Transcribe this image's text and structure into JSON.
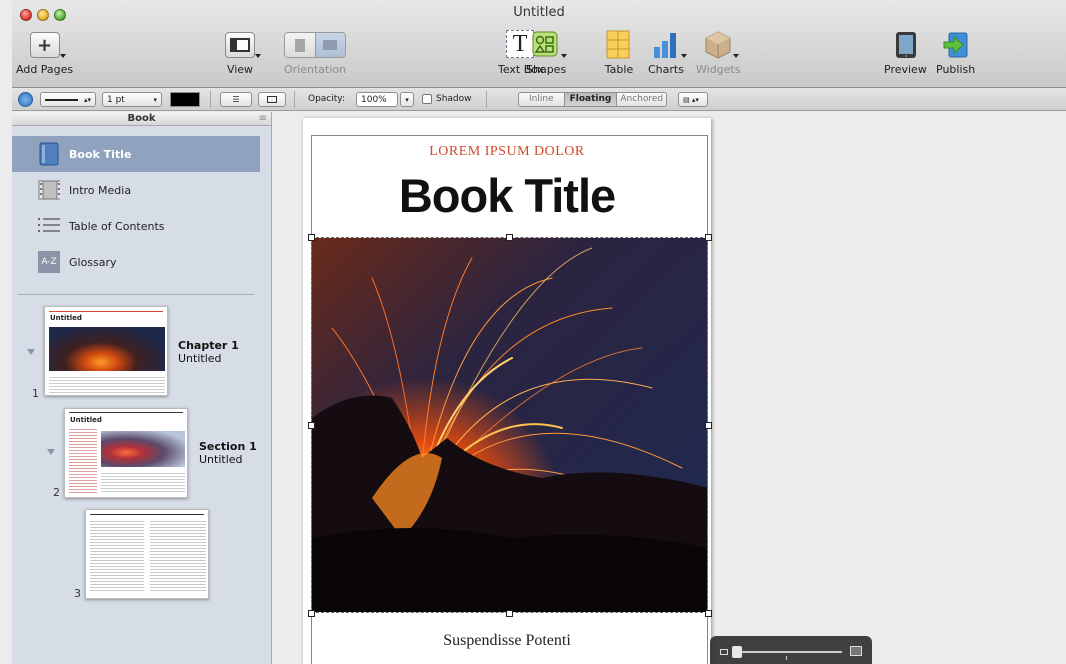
{
  "window": {
    "title": "Untitled"
  },
  "toolbar": {
    "add_pages": "Add Pages",
    "view": "View",
    "orientation": "Orientation",
    "text_box": "Text Box",
    "text_box_glyph": "T",
    "shapes": "Shapes",
    "table": "Table",
    "charts": "Charts",
    "widgets": "Widgets",
    "preview": "Preview",
    "publish": "Publish"
  },
  "format_bar": {
    "stroke_width": "1 pt",
    "opacity_label": "Opacity:",
    "opacity_value": "100%",
    "shadow_label": "Shadow",
    "wrap_inline": "Inline",
    "wrap_floating": "Floating",
    "wrap_anchored": "Anchored",
    "fill_color": "#000000"
  },
  "sidebar": {
    "header": "Book",
    "items": [
      {
        "label": "Book Title",
        "icon": "book-icon",
        "selected": true
      },
      {
        "label": "Intro Media",
        "icon": "film-icon",
        "selected": false
      },
      {
        "label": "Table of Contents",
        "icon": "list-icon",
        "selected": false
      },
      {
        "label": "Glossary",
        "icon": "glossary-icon",
        "icon_text": "A-Z",
        "selected": false
      }
    ],
    "pages": [
      {
        "number": "1",
        "heading": "Chapter 1",
        "subheading": "Untitled",
        "thumb_title": "Untitled"
      },
      {
        "number": "2",
        "heading": "Section 1",
        "subheading": "Untitled",
        "thumb_title": "Untitled"
      },
      {
        "number": "3"
      }
    ]
  },
  "document": {
    "kicker": "LOREM IPSUM DOLOR",
    "title": "Book Title",
    "subtitle": "Suspendisse Potenti"
  },
  "colors": {
    "accent_red": "#d04a2a",
    "selection_blue": "#8fa3bf"
  }
}
